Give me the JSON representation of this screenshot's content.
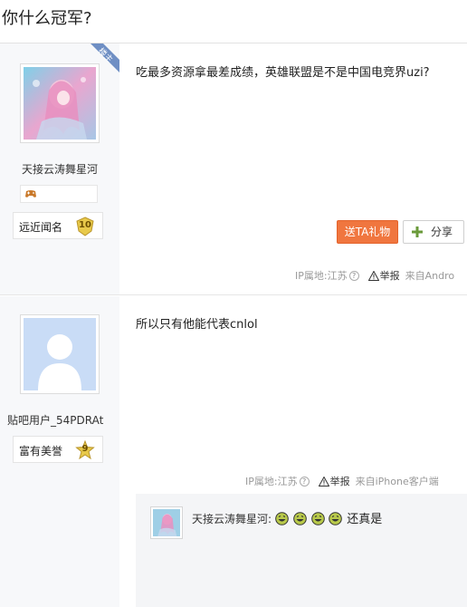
{
  "thread": {
    "title": "你什么冠军?"
  },
  "posts": [
    {
      "username": "天接云涛舞星河",
      "author_badge": "楼主",
      "level_name": "远近闻名",
      "level": "10",
      "content": "吃最多资源拿最差成绩，英雄联盟是不是中国电竞界uzi?",
      "gift_label": "送TA礼物",
      "share_label": "分享",
      "ip_location": "IP属地:江苏",
      "report_label": "举报",
      "source": "来自Andro"
    },
    {
      "username": "贴吧用户_54PDRAt",
      "level_name": "富有美誉",
      "level": "9",
      "content": "所以只有他能代表cnlol",
      "ip_location": "IP属地:江苏",
      "report_label": "举报",
      "source": "来自iPhone客户端",
      "reply": {
        "username": "天接云涛舞星河:",
        "text": "还真是",
        "emoji_count": 4
      }
    }
  ],
  "colors": {
    "gift_button": "#f0763f",
    "author_badge": "#6f8fc4",
    "level_badge": "#e8c94a"
  },
  "icons": [
    "game-controller-icon",
    "level-badge-icon",
    "share-plus-icon",
    "question-icon",
    "warning-icon",
    "laugh-emoji-icon"
  ]
}
